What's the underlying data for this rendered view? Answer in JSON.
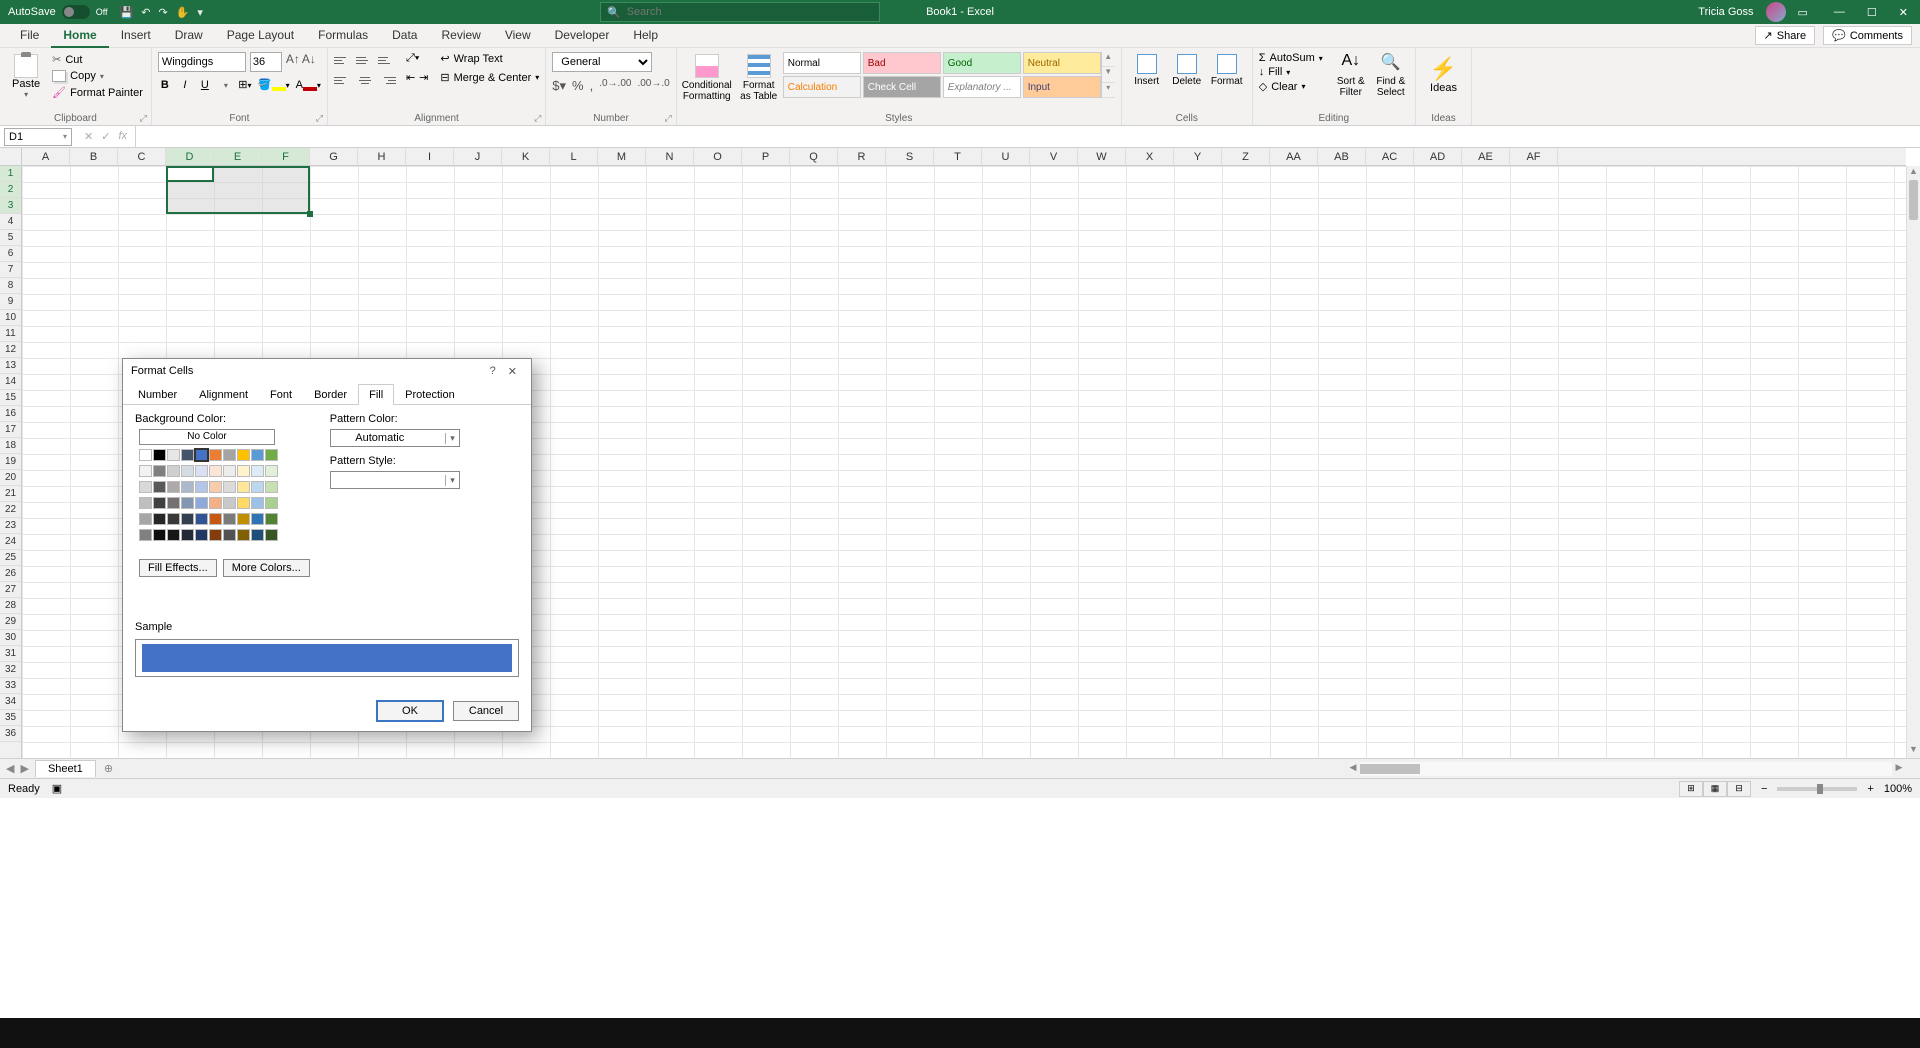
{
  "titlebar": {
    "autosave_label": "AutoSave",
    "autosave_state": "Off",
    "title": "Book1 - Excel",
    "search_placeholder": "Search",
    "user_name": "Tricia Goss"
  },
  "menu": {
    "tabs": [
      "File",
      "Home",
      "Insert",
      "Draw",
      "Page Layout",
      "Formulas",
      "Data",
      "Review",
      "View",
      "Developer",
      "Help"
    ],
    "share": "Share",
    "comments": "Comments"
  },
  "ribbon": {
    "clipboard": {
      "paste": "Paste",
      "cut": "Cut",
      "copy": "Copy",
      "painter": "Format Painter",
      "label": "Clipboard"
    },
    "font": {
      "name": "Wingdings",
      "size": "36",
      "bold": "B",
      "italic": "I",
      "underline": "U",
      "label": "Font"
    },
    "alignment": {
      "wrap": "Wrap Text",
      "merge": "Merge & Center",
      "label": "Alignment"
    },
    "number": {
      "format": "General",
      "label": "Number"
    },
    "styles": {
      "cf": "Conditional Formatting",
      "fat": "Format as Table",
      "gallery": [
        "Normal",
        "Bad",
        "Good",
        "Neutral",
        "Calculation",
        "Check Cell",
        "Explanatory ...",
        "Input"
      ],
      "gallery_colors": [
        {
          "bg": "#ffffff",
          "fg": "#000"
        },
        {
          "bg": "#ffc7ce",
          "fg": "#9c0006"
        },
        {
          "bg": "#c6efce",
          "fg": "#006100"
        },
        {
          "bg": "#ffeb9c",
          "fg": "#9c6500"
        },
        {
          "bg": "#f2f2f2",
          "fg": "#fa7d00"
        },
        {
          "bg": "#a5a5a5",
          "fg": "#fff"
        },
        {
          "bg": "#ffffff",
          "fg": "#7f7f7f"
        },
        {
          "bg": "#ffcc99",
          "fg": "#3f3f76"
        }
      ],
      "label": "Styles"
    },
    "cells": {
      "insert": "Insert",
      "delete": "Delete",
      "format": "Format",
      "label": "Cells"
    },
    "editing": {
      "autosum": "AutoSum",
      "fill": "Fill",
      "clear": "Clear",
      "sort": "Sort & Filter",
      "find": "Find & Select",
      "label": "Editing"
    },
    "ideas": {
      "label": "Ideas"
    }
  },
  "formulabar": {
    "namebox": "D1"
  },
  "grid": {
    "columns": [
      "A",
      "B",
      "C",
      "D",
      "E",
      "F",
      "G",
      "H",
      "I",
      "J",
      "K",
      "L",
      "M",
      "N",
      "O",
      "P",
      "Q",
      "R",
      "S",
      "T",
      "U",
      "V",
      "W",
      "X",
      "Y",
      "Z",
      "AA",
      "AB",
      "AC",
      "AD",
      "AE",
      "AF"
    ],
    "rows": 36,
    "selected_cols": [
      "D",
      "E",
      "F"
    ],
    "selected_rows": [
      1,
      2,
      3
    ],
    "active_cell": "D1"
  },
  "sheets": {
    "tab": "Sheet1"
  },
  "statusbar": {
    "ready": "Ready",
    "zoom": "100%"
  },
  "dialog": {
    "title": "Format Cells",
    "tabs": [
      "Number",
      "Alignment",
      "Font",
      "Border",
      "Fill",
      "Protection"
    ],
    "active_tab": "Fill",
    "bg_label": "Background Color:",
    "nocolor": "No Color",
    "pattern_color_label": "Pattern Color:",
    "pattern_color_value": "Automatic",
    "pattern_style_label": "Pattern Style:",
    "fill_effects": "Fill Effects...",
    "more_colors": "More Colors...",
    "sample": "Sample",
    "ok": "OK",
    "cancel": "Cancel",
    "theme_colors_row1": [
      "#ffffff",
      "#000000",
      "#e7e6e6",
      "#44546a",
      "#4472c4",
      "#ed7d31",
      "#a5a5a5",
      "#ffc000",
      "#5b9bd5",
      "#70ad47"
    ],
    "theme_tints": [
      [
        "#f2f2f2",
        "#808080",
        "#d0cece",
        "#d6dce4",
        "#d9e1f2",
        "#fce4d6",
        "#ededed",
        "#fff2cc",
        "#ddebf7",
        "#e2efda"
      ],
      [
        "#d9d9d9",
        "#595959",
        "#aeaaaa",
        "#acb9ca",
        "#b4c6e7",
        "#f8cbad",
        "#dbdbdb",
        "#ffe699",
        "#bdd7ee",
        "#c6e0b4"
      ],
      [
        "#bfbfbf",
        "#404040",
        "#757171",
        "#8497b0",
        "#8ea9db",
        "#f4b084",
        "#c9c9c9",
        "#ffd966",
        "#9bc2e6",
        "#a9d08e"
      ],
      [
        "#a6a6a6",
        "#262626",
        "#3a3838",
        "#333f4f",
        "#305496",
        "#c65911",
        "#7b7b7b",
        "#bf8f00",
        "#2f75b5",
        "#548235"
      ],
      [
        "#808080",
        "#0d0d0d",
        "#161616",
        "#222b35",
        "#203764",
        "#833c0c",
        "#525252",
        "#806000",
        "#1f4e78",
        "#375623"
      ]
    ],
    "standard_colors": [
      "#c00000",
      "#ff0000",
      "#ffc000",
      "#ffff00",
      "#92d050",
      "#00b050",
      "#00b0f0",
      "#0070c0",
      "#002060",
      "#7030a0"
    ],
    "selected_theme": 4
  }
}
